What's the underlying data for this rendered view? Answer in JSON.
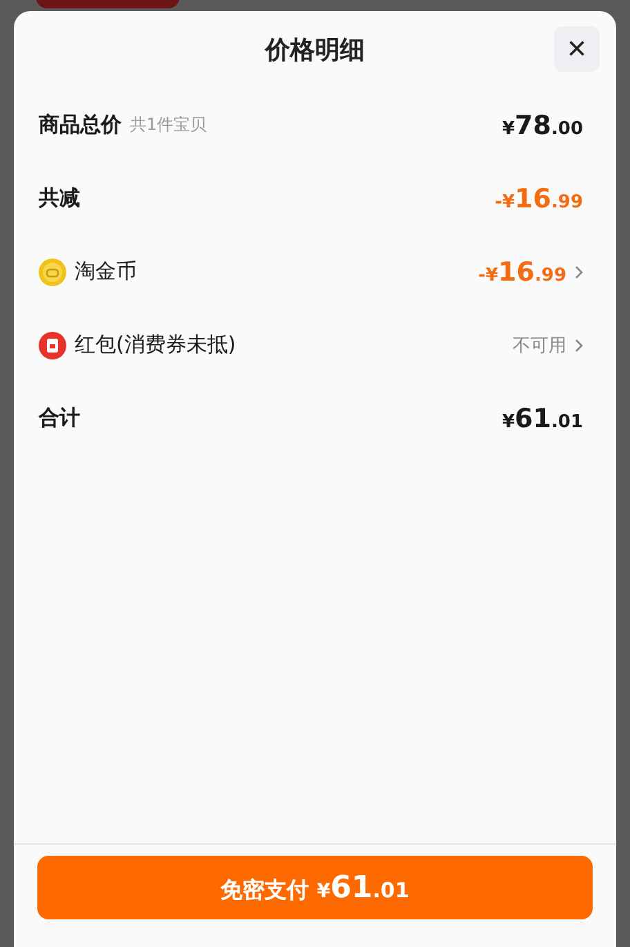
{
  "sheet": {
    "title": "价格明细",
    "close": "×"
  },
  "rows": [
    {
      "kind": "subtotal",
      "label": "商品总价",
      "note": "共1件宝贝",
      "amount": {
        "currency": "¥",
        "whole": "78",
        "fraction": ".00"
      },
      "chevron": false
    },
    {
      "kind": "discount",
      "label": "共减",
      "amount": {
        "currency": "-¥",
        "whole": "16",
        "fraction": ".99"
      },
      "chevron": false
    },
    {
      "kind": "coin",
      "label": "淘金币",
      "amount": {
        "currency": "-¥",
        "whole": "16",
        "fraction": ".99"
      },
      "chevron": true
    },
    {
      "kind": "packet",
      "label": "红包(消费券未抵)",
      "status": "不可用",
      "chevron": true
    },
    {
      "kind": "total",
      "label": "合计",
      "amount": {
        "currency": "¥",
        "whole": "61",
        "fraction": ".01"
      },
      "chevron": false
    }
  ],
  "pay_button": {
    "label": "免密支付",
    "amount": {
      "currency": "¥",
      "whole": "61",
      "fraction": ".01"
    }
  }
}
